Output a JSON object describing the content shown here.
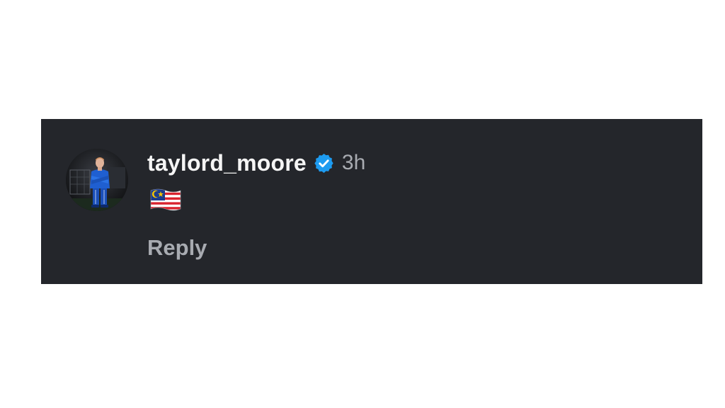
{
  "comment": {
    "username": "taylord_moore",
    "verified_icon": "verified-badge-icon",
    "timestamp": "3h",
    "body_emoji_icon": "malaysia-flag-emoji",
    "reply_label": "Reply"
  },
  "colors": {
    "card_background": "#24262b",
    "page_background": "#ffffff",
    "username_text": "#f5f5f5",
    "muted_text": "#a8abb1",
    "verified_blue": "#1d9bf0"
  }
}
